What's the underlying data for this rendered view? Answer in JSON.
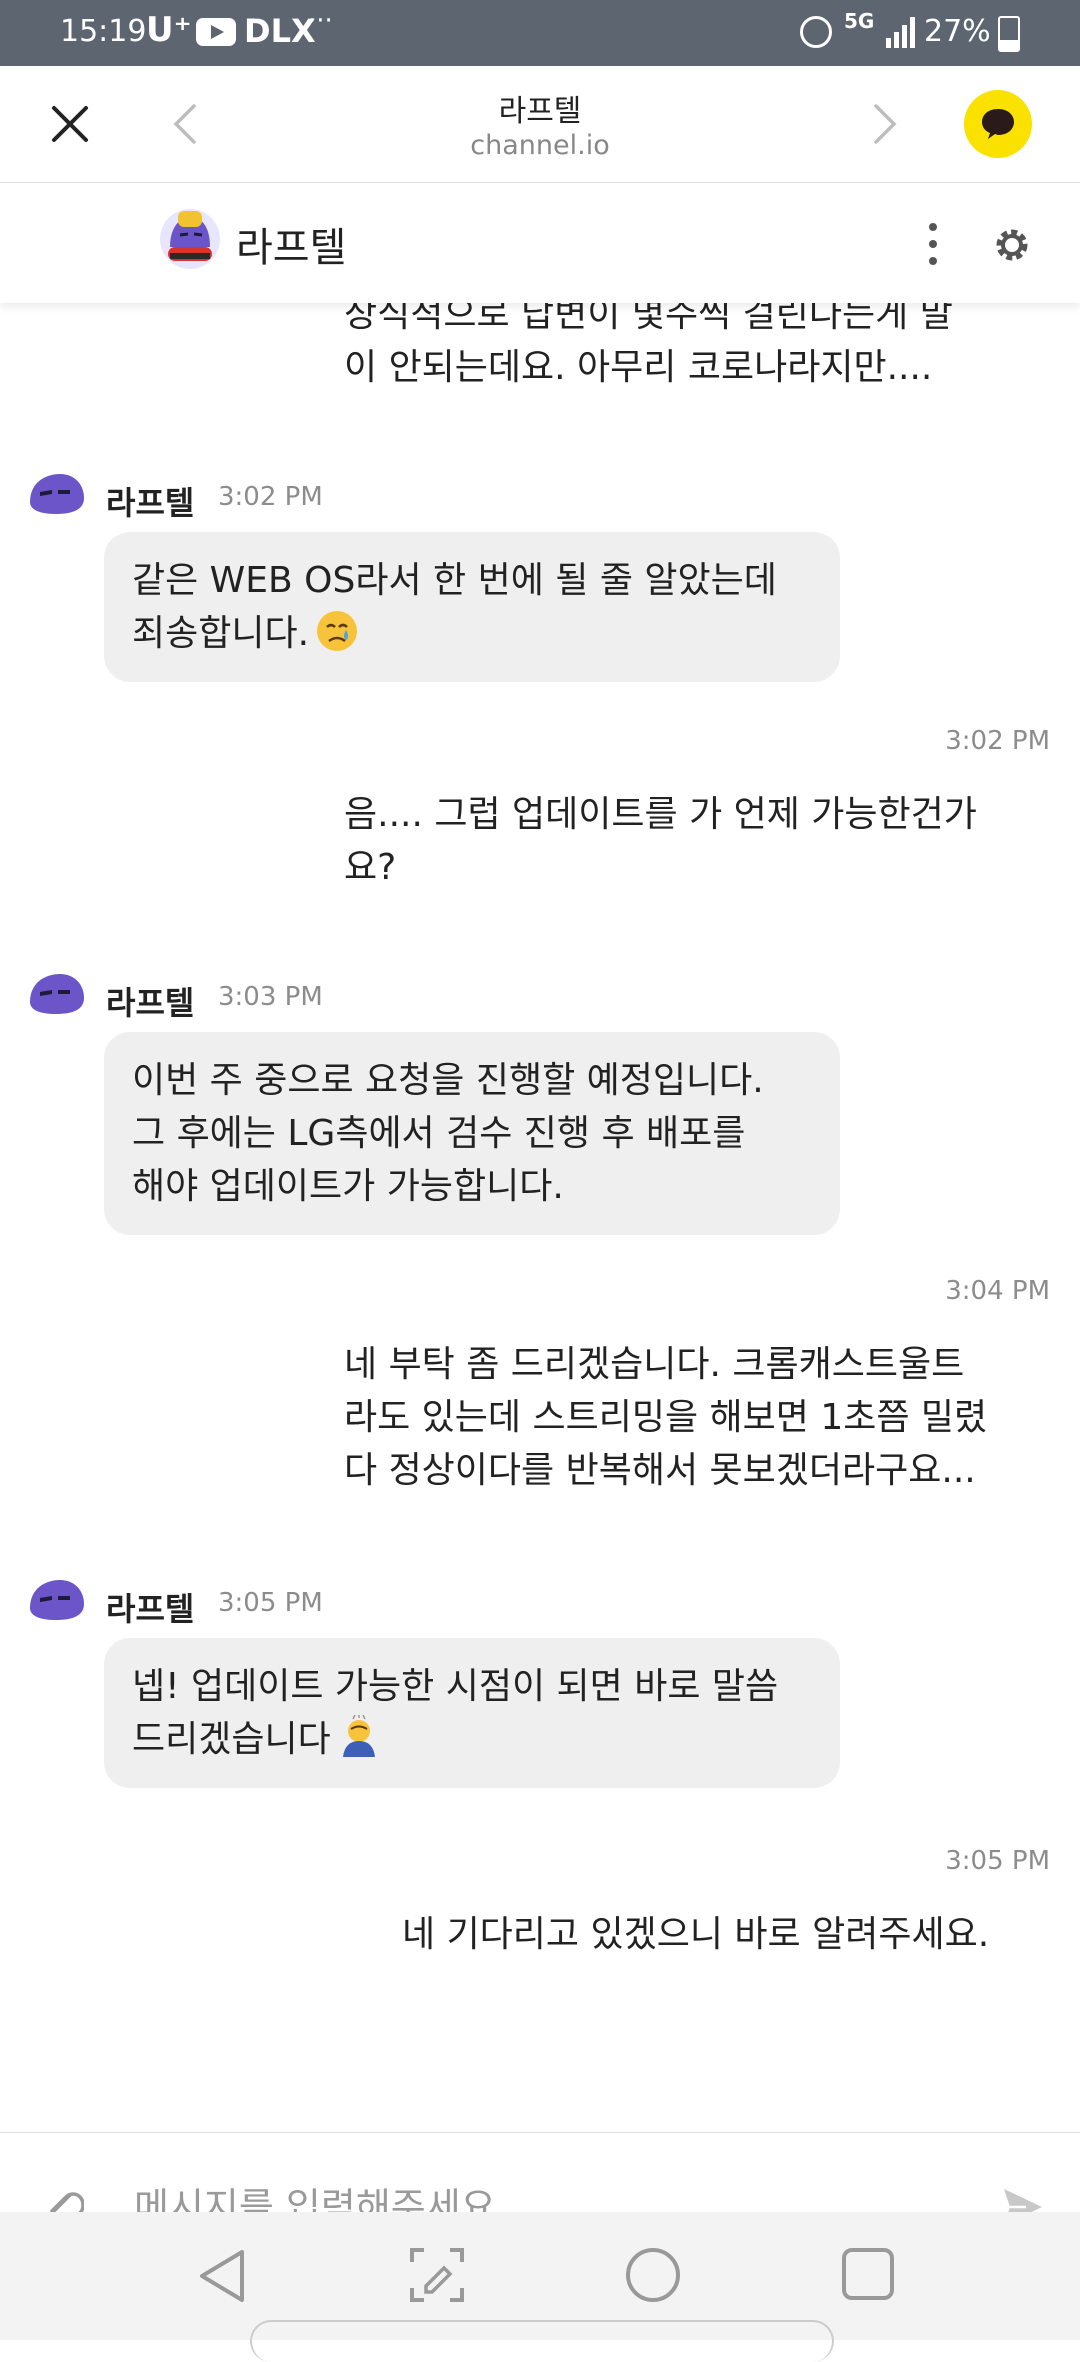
{
  "status_bar": {
    "time": "15:19",
    "carrier": "U⁺",
    "dlx": "DLX",
    "network": "5G",
    "battery": "27%"
  },
  "browser": {
    "title": "라프텔",
    "url": "channel.io"
  },
  "channel": {
    "name": "라프텔"
  },
  "messages": {
    "m0_user": "상식적으로 답변이 몇주씩 걸린다는게 말\n이 안되는데요. 아무리 코로나라지만....",
    "m1_bot_name": "라프텔",
    "m1_bot_time": "3:02 PM",
    "m1_bot_text": "같은 WEB OS라서 한 번에 될 줄 알았는데\n죄송합니다.",
    "m2_user_time": "3:02 PM",
    "m2_user_text": "음.... 그럽 업데이트를 가 언제 가능한건가\n요?",
    "m3_bot_name": "라프텔",
    "m3_bot_time": "3:03 PM",
    "m3_bot_text": "이번 주 중으로 요청을 진행할 예정입니다.\n그 후에는 LG측에서 검수 진행 후 배포를\n해야 업데이트가 가능합니다.",
    "m4_user_time": "3:04 PM",
    "m4_user_text": "네 부탁 좀 드리겠습니다. 크롬캐스트울트\n라도 있는데 스트리밍을 해보면 1초쯤 밀렸\n다 정상이다를 반복해서 못보겠더라구요...",
    "m5_bot_name": "라프텔",
    "m5_bot_time": "3:05 PM",
    "m5_bot_text": "넵! 업데이트 가능한 시점이 되면 바로 말씀\n드리겠습니다",
    "m6_user_time": "3:05 PM",
    "m6_user_text": "네 기다리고 있겠으니 바로 알려주세요."
  },
  "input": {
    "placeholder": "메시지를 입력해주세요."
  },
  "colors": {
    "accent_yellow": "#fae100",
    "bubble_gray": "#efefef",
    "brand_purple": "#6b55c8",
    "status_bar": "#5d6670"
  },
  "icons": {
    "close": "close-icon",
    "back": "chevron-left-icon",
    "forward": "chevron-right-icon",
    "kakao": "chat-bubble-icon",
    "more": "more-vertical-icon",
    "settings": "gear-icon",
    "attach": "paperclip-icon",
    "send": "send-icon"
  }
}
